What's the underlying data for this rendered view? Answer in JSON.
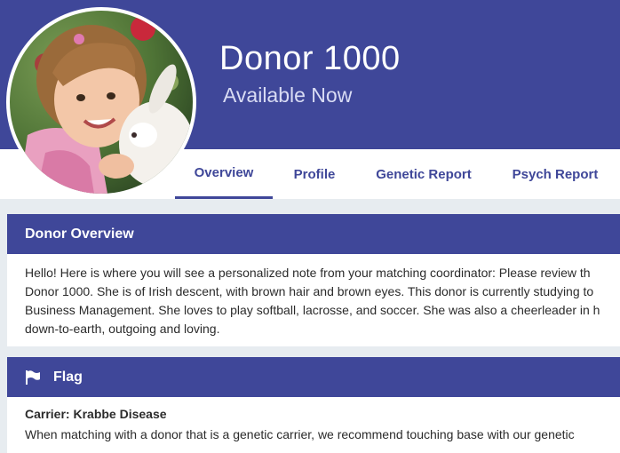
{
  "donor": {
    "name": "Donor 1000",
    "status": "Available Now"
  },
  "tabs": [
    {
      "label": "Overview",
      "active": true
    },
    {
      "label": "Profile",
      "active": false
    },
    {
      "label": "Genetic Report",
      "active": false
    },
    {
      "label": "Psych Report",
      "active": false
    }
  ],
  "overview": {
    "heading": "Donor Overview",
    "lines": [
      "Hello! Here is where you will see a personalized note from your matching coordinator: Please review th",
      "Donor 1000. She is of Irish descent, with brown hair and brown eyes. This donor is currently studying to",
      "Business Management. She loves to play softball, lacrosse, and soccer. She was also a cheerleader in h",
      "down-to-earth, outgoing and loving."
    ]
  },
  "flag": {
    "heading": "Flag",
    "icon": "flag-icon",
    "carrier_title": "Carrier: Krabbe Disease",
    "carrier_text": "When matching with a donor that is a genetic carrier, we recommend touching base with our genetic"
  },
  "colors": {
    "brand": "#3f4799",
    "page_bg": "#e7ecf0"
  }
}
